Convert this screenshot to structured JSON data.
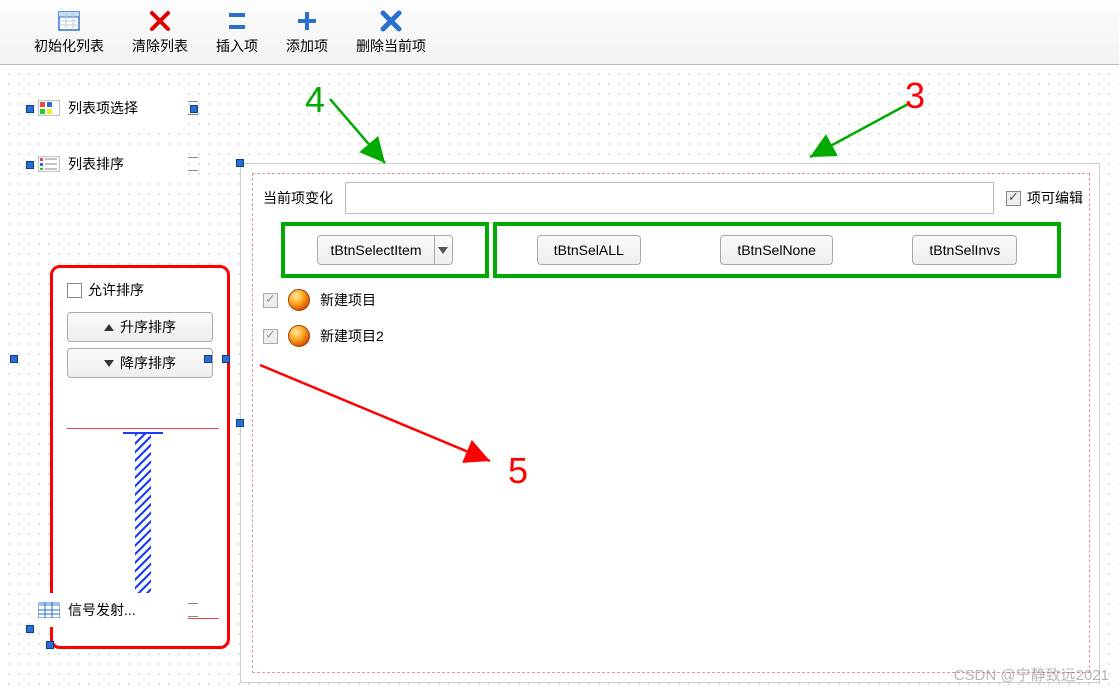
{
  "toolbar": {
    "init_list": "初始化列表",
    "clear_list": "清除列表",
    "insert_item": "插入项",
    "add_item": "添加项",
    "delete_current": "删除当前项"
  },
  "sidebar": {
    "item_select": "列表项选择",
    "list_sort": "列表排序",
    "signal_emit": "信号发射..."
  },
  "sort": {
    "allow": "允许排序",
    "asc": "升序排序",
    "desc": "降序排序"
  },
  "main": {
    "current_item_change": "当前项变化",
    "editable_label": "项可编辑",
    "combo_label": "tBtnSelectItem",
    "btn_sel_all": "tBtnSelALL",
    "btn_sel_none": "tBtnSelNone",
    "btn_sel_invs": "tBtnSelInvs",
    "list_items": [
      "新建项目",
      "新建项目2"
    ]
  },
  "annotations": {
    "n3": "3",
    "n4": "4",
    "n5": "5"
  },
  "watermark": "CSDN @宁静致远2021"
}
